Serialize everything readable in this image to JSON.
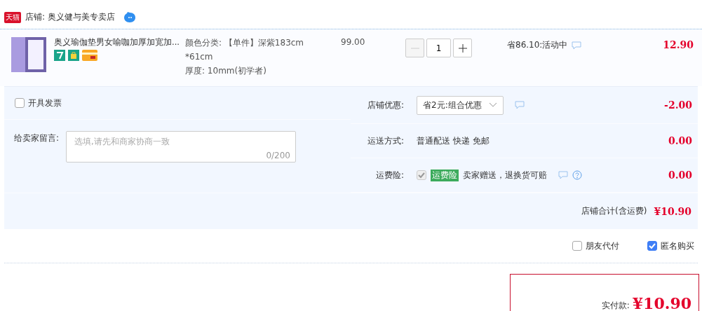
{
  "shop": {
    "badge": "天猫",
    "label": "店铺: 奥义健与美专卖店"
  },
  "item": {
    "title": "奥义瑜伽垫男女喻咖加厚加宽加...",
    "sku": [
      "颜色分类: 【单件】深紫183cm",
      "*61cm",
      "厚度: 10mm(初学者)"
    ],
    "unit_price": "99.00",
    "quantity": "1",
    "minus_disabled": true,
    "promo": "省86.10:活动中",
    "subtotal": "12.90"
  },
  "invoice": {
    "label": "开具发票",
    "checked": false
  },
  "message": {
    "label": "给卖家留言:",
    "placeholder": "选填,请先和商家协商一致",
    "counter": "0/200"
  },
  "discount": {
    "label": "店铺优惠:",
    "value": "省2元:组合优惠",
    "amount": "-2.00"
  },
  "shipping": {
    "label": "运送方式:",
    "value": "普通配送 快递 免邮",
    "amount": "0.00"
  },
  "insurance": {
    "label": "运费险:",
    "checked": true,
    "tag": "运费险",
    "text": "卖家赠送，退换货可赔",
    "amount": "0.00"
  },
  "shop_total": {
    "label": "店铺合计(含运费)",
    "amount": "¥10.90"
  },
  "options": [
    {
      "label": "朋友代付",
      "checked": false
    },
    {
      "label": "匿名购买",
      "checked": true
    }
  ],
  "pay": {
    "label": "实付款:",
    "amount": "¥10.90"
  }
}
